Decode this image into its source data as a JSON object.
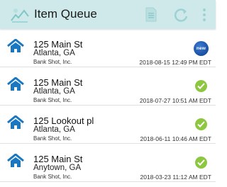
{
  "toolbar": {
    "title": "Item Queue",
    "accent": "#cfe9ea",
    "icons": [
      "app-logo-icon",
      "document-icon",
      "refresh-icon",
      "more-vert-icon"
    ]
  },
  "items": [
    {
      "address": "125 Main St",
      "city": "Atlanta, GA",
      "company": "Bank Shot, Inc.",
      "timestamp": "2018-08-15 12:49 PM EDT",
      "status": "new",
      "status_label": "new"
    },
    {
      "address": "125 Main St",
      "city": "Atlanta, GA",
      "company": "Bank Shot, Inc.",
      "timestamp": "2018-07-27 10:51 AM EDT",
      "status": "complete"
    },
    {
      "address": "125 Lookout pl",
      "city": "Atlanta, GA",
      "company": "Bank Shot, Inc.",
      "timestamp": "2018-06-11 10:46 AM EDT",
      "status": "complete"
    },
    {
      "address": "125 Main St",
      "city": "Anytown, GA",
      "company": "Bank Shot, Inc.",
      "timestamp": "2018-03-23 11:12 AM EDT",
      "status": "complete"
    }
  ],
  "colors": {
    "house": "#1a78c2",
    "check": "#8dc63f",
    "new_badge": "#1a4fa0"
  }
}
